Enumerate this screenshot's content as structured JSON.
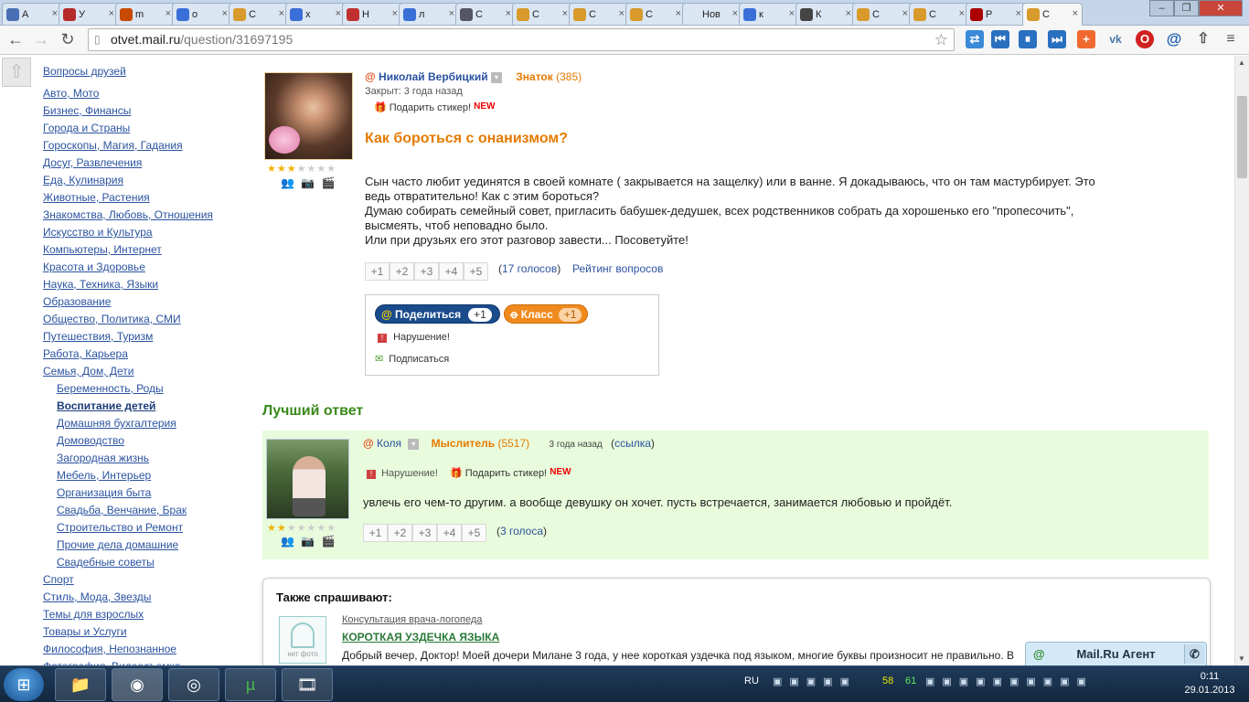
{
  "browser": {
    "tabs": [
      {
        "label": "А",
        "color": "#4a6fb5"
      },
      {
        "label": "У",
        "color": "#b52a2a"
      },
      {
        "label": "m",
        "color": "#c84a00"
      },
      {
        "label": "о",
        "color": "#3a6fd8"
      },
      {
        "label": "С",
        "color": "#d89a2a"
      },
      {
        "label": "х",
        "color": "#3a6fd8"
      },
      {
        "label": "Н",
        "color": "#c03030"
      },
      {
        "label": "л",
        "color": "#3a6fd8"
      },
      {
        "label": "С",
        "color": "#556"
      },
      {
        "label": "С",
        "color": "#d89a2a"
      },
      {
        "label": "С",
        "color": "#d89a2a"
      },
      {
        "label": "С",
        "color": "#d89a2a"
      },
      {
        "label": "Нов",
        "color": "#dbe6f3"
      },
      {
        "label": "к",
        "color": "#3a6fd8"
      },
      {
        "label": "К",
        "color": "#444"
      },
      {
        "label": "С",
        "color": "#d89a2a"
      },
      {
        "label": "С",
        "color": "#d89a2a"
      },
      {
        "label": "Р",
        "color": "#a00"
      },
      {
        "label": "С",
        "color": "#d89a2a"
      }
    ],
    "address_host": "otvet.mail.ru",
    "address_path": "/question/31697195"
  },
  "sidebar": {
    "top_link": "Вопросы друзей",
    "items": [
      {
        "label": "Авто, Мото"
      },
      {
        "label": "Бизнес, Финансы"
      },
      {
        "label": "Города и Страны"
      },
      {
        "label": "Гороскопы, Магия, Гадания"
      },
      {
        "label": "Досуг, Развлечения"
      },
      {
        "label": "Еда, Кулинария"
      },
      {
        "label": "Животные, Растения"
      },
      {
        "label": "Знакомства, Любовь, Отношения"
      },
      {
        "label": "Искусство и Культура"
      },
      {
        "label": "Компьютеры, Интернет"
      },
      {
        "label": "Красота и Здоровье"
      },
      {
        "label": "Наука, Техника, Языки"
      },
      {
        "label": "Образование"
      },
      {
        "label": "Общество, Политика, СМИ"
      },
      {
        "label": "Путешествия, Туризм"
      },
      {
        "label": "Работа, Карьера"
      },
      {
        "label": "Семья, Дом, Дети"
      }
    ],
    "sub_items": [
      {
        "label": "Беременность, Роды"
      },
      {
        "label": "Воспитание детей"
      },
      {
        "label": "Домашняя бухгалтерия"
      },
      {
        "label": "Домоводство"
      },
      {
        "label": "Загородная жизнь"
      },
      {
        "label": "Мебель, Интерьер"
      },
      {
        "label": "Организация быта"
      },
      {
        "label": "Свадьба, Венчание, Брак"
      },
      {
        "label": "Строительство и Ремонт"
      },
      {
        "label": "Прочие дела домашние"
      },
      {
        "label": "Свадебные советы"
      }
    ],
    "after_items": [
      {
        "label": "Спорт"
      },
      {
        "label": "Стиль, Мода, Звезды"
      },
      {
        "label": "Темы для взрослых"
      },
      {
        "label": "Товары и Услуги"
      },
      {
        "label": "Философия, Непознанное"
      },
      {
        "label": "Фотография, Видеосъемка"
      }
    ]
  },
  "question": {
    "author": "Николай Вербицкий",
    "rank": "Знаток",
    "points": "(385)",
    "status": "Закрыт: 3 года назад",
    "gift": "Подарить стикер!",
    "new_badge": "NEW",
    "title": "Как бороться с онанизмом?",
    "text_lines": [
      "Сын часто любит уединятся в своей комнате ( закрывается на защелку) или в ванне. Я докадываюсь, что он там мастурбирует. Это",
      "ведь отвратительно! Как с этим бороться?",
      "Думаю собирать семейный совет, пригласить бабушек-дедушек, всех родственников собрать да хорошенько его \"пропесочить\",",
      "высмеять, чтоб неповадно было.",
      "Или при друзьях его этот разговор завести... Посоветуйте!"
    ],
    "stars_filled": 3,
    "stars_total": 7,
    "votes": [
      "+1",
      "+2",
      "+3",
      "+4",
      "+5"
    ],
    "votes_count": "17 голосов",
    "rating_link": "Рейтинг вопросов",
    "share_label": "Поделиться",
    "share_count": "+1",
    "class_label": "Класс",
    "class_count": "+1",
    "report": "Нарушение!",
    "subscribe": "Подписаться"
  },
  "best_answer": {
    "heading": "Лучший ответ",
    "author": "Коля",
    "rank": "Мыслитель",
    "points": "(5517)",
    "time": "3 года назад",
    "link": "ссылка",
    "report": "Нарушение!",
    "gift": "Подарить стикер!",
    "new_badge": "NEW",
    "text": "увлечь его чем-то другим. а вообще девушку он хочет. пусть встречается, занимается любовью и пройдёт.",
    "stars_filled": 2,
    "stars_total": 7,
    "votes": [
      "+1",
      "+2",
      "+3",
      "+4",
      "+5"
    ],
    "votes_count": "3 голоса"
  },
  "also_asked": {
    "heading": "Также спрашивают:",
    "no_photo": "нет фото",
    "category": "Консультация врача-логопеда",
    "title": "КОРОТКАЯ УЗДЕЧКА ЯЗЫКА",
    "text": "Добрый вечер, Доктор! Моей дочери Милане 3 года, у нее короткая уздечка под языком, многие буквы произносит не правильно. В"
  },
  "agent": {
    "label": "Mail.Ru Агент"
  },
  "taskbar": {
    "lang": "RU",
    "temp1": "58",
    "temp2": "61",
    "time": "0:11",
    "date": "29.01.2013"
  },
  "colors": {
    "accent_orange": "#e57a00",
    "link_blue": "#2b53a0",
    "best_green": "#3a8a1a",
    "best_bg": "#e8fbdc"
  }
}
